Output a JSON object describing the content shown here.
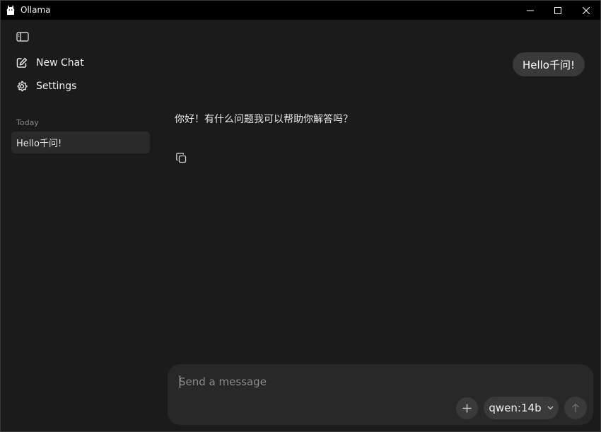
{
  "window": {
    "title": "Ollama",
    "icons": {
      "app": "llama-icon",
      "minimize": "minimize-icon",
      "maximize": "maximize-icon",
      "close": "close-icon"
    }
  },
  "sidebar": {
    "toggle_icon": "sidebar-toggle-icon",
    "new_chat_label": "New Chat",
    "settings_label": "Settings",
    "section_label": "Today",
    "history": [
      {
        "title": "Hello千问!"
      }
    ]
  },
  "chat": {
    "messages": [
      {
        "role": "user",
        "text": "Hello千问!"
      },
      {
        "role": "assistant",
        "text": "你好！有什么问题我可以帮助你解答吗？"
      }
    ]
  },
  "composer": {
    "placeholder": "Send a message",
    "value": "",
    "model": "qwen:14b"
  },
  "colors": {
    "background": "#1b1b1b",
    "titlebar": "#000000",
    "bubble": "#3a3a3a",
    "composer": "#282828",
    "selected_item": "#2a2a2a"
  }
}
